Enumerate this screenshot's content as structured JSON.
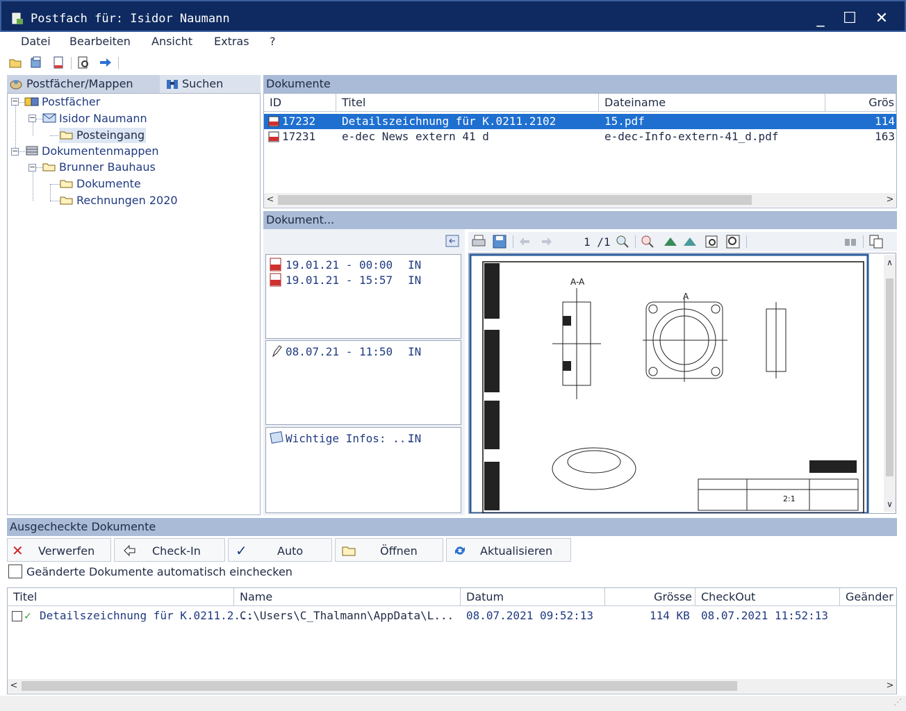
{
  "window": {
    "title": "Postfach für: Isidor Naumann",
    "controls": [
      "_",
      "☐",
      "✕"
    ]
  },
  "menu": [
    "Datei",
    "Bearbeiten",
    "Ansicht",
    "Extras",
    "?"
  ],
  "left_tabs": {
    "folders": "Postfächer/Mappen",
    "search": "Suchen"
  },
  "tree": [
    {
      "label": "Postfächer"
    },
    {
      "label": "Isidor Naumann"
    },
    {
      "label": "Posteingang"
    },
    {
      "label": "Dokumentenmappen"
    },
    {
      "label": "Brunner Bauhaus"
    },
    {
      "label": "Dokumente"
    },
    {
      "label": "Rechnungen 2020"
    }
  ],
  "documents": {
    "header": "Dokumente",
    "columns": [
      "ID",
      "Titel",
      "Dateiname",
      "Grös"
    ],
    "rows": [
      {
        "id": "17232",
        "title": "Detailszeichnung für K.0211.2102",
        "filename": "15.pdf",
        "size": "114"
      },
      {
        "id": "17231",
        "title": "e-dec News extern 41 d",
        "filename": "e-dec-Info-extern-41_d.pdf",
        "size": "163"
      }
    ]
  },
  "preview": {
    "header": "Dokument...",
    "page_indicator": "1 /1",
    "history": [
      {
        "when": "19.01.21 - 00:00",
        "dir": "IN"
      },
      {
        "when": "19.01.21 - 15:57",
        "dir": "IN"
      }
    ],
    "note": {
      "when": "08.07.21 - 11:50",
      "dir": "IN"
    },
    "info": {
      "text": "Wichtige Infos: ...",
      "dir": "IN"
    }
  },
  "checkout": {
    "header": "Ausgecheckte Dokumente",
    "buttons": {
      "discard": "Verwerfen",
      "checkin": "Check-In",
      "auto": "Auto",
      "open": "Öffnen",
      "refresh": "Aktualisieren"
    },
    "auto_checkbox_label": "Geänderte Dokumente automatisch einchecken",
    "columns": [
      "Titel",
      "Name",
      "Datum",
      "Grösse",
      "CheckOut",
      "Geänder"
    ],
    "rows": [
      {
        "title": "Detailszeichnung für K.0211.2...",
        "name": "C:\\Users\\C_Thalmann\\AppData\\L...",
        "date": "08.07.2021 09:52:13",
        "size": "114 KB",
        "checkout": "08.07.2021 11:52:13"
      }
    ]
  },
  "drawing_labels": {
    "section": "A-A",
    "marker": "A",
    "scale": "2:1"
  },
  "colors": {
    "titlebar": "#0f2a60",
    "section_header": "#a9bbd6",
    "selection": "#1e6fd0"
  }
}
